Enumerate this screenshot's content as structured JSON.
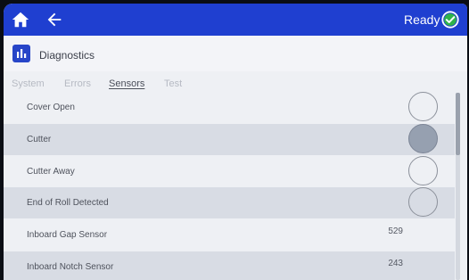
{
  "header": {
    "status": "Ready",
    "accent": "#1f3fd0"
  },
  "title": "Diagnostics",
  "tabs": [
    {
      "label": "System",
      "active": false
    },
    {
      "label": "Errors",
      "active": false
    },
    {
      "label": "Sensors",
      "active": true
    },
    {
      "label": "Test",
      "active": false
    }
  ],
  "sensors": [
    {
      "label": "Cover Open",
      "indicator": "off"
    },
    {
      "label": "Cutter",
      "indicator": "on"
    },
    {
      "label": "Cutter Away",
      "indicator": "off"
    },
    {
      "label": "End of Roll Detected",
      "indicator": "off"
    },
    {
      "label": "Inboard Gap Sensor",
      "value": "529"
    },
    {
      "label": "Inboard Notch Sensor",
      "value": "243"
    }
  ]
}
